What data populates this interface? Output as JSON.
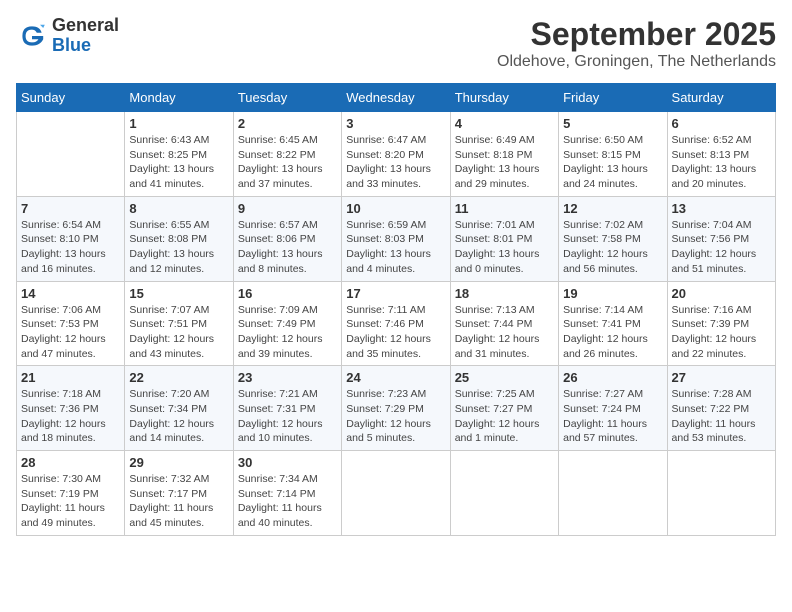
{
  "header": {
    "logo_general": "General",
    "logo_blue": "Blue",
    "month_title": "September 2025",
    "location": "Oldehove, Groningen, The Netherlands"
  },
  "days_of_week": [
    "Sunday",
    "Monday",
    "Tuesday",
    "Wednesday",
    "Thursday",
    "Friday",
    "Saturday"
  ],
  "weeks": [
    [
      {
        "day": "",
        "info": ""
      },
      {
        "day": "1",
        "info": "Sunrise: 6:43 AM\nSunset: 8:25 PM\nDaylight: 13 hours\nand 41 minutes."
      },
      {
        "day": "2",
        "info": "Sunrise: 6:45 AM\nSunset: 8:22 PM\nDaylight: 13 hours\nand 37 minutes."
      },
      {
        "day": "3",
        "info": "Sunrise: 6:47 AM\nSunset: 8:20 PM\nDaylight: 13 hours\nand 33 minutes."
      },
      {
        "day": "4",
        "info": "Sunrise: 6:49 AM\nSunset: 8:18 PM\nDaylight: 13 hours\nand 29 minutes."
      },
      {
        "day": "5",
        "info": "Sunrise: 6:50 AM\nSunset: 8:15 PM\nDaylight: 13 hours\nand 24 minutes."
      },
      {
        "day": "6",
        "info": "Sunrise: 6:52 AM\nSunset: 8:13 PM\nDaylight: 13 hours\nand 20 minutes."
      }
    ],
    [
      {
        "day": "7",
        "info": "Sunrise: 6:54 AM\nSunset: 8:10 PM\nDaylight: 13 hours\nand 16 minutes."
      },
      {
        "day": "8",
        "info": "Sunrise: 6:55 AM\nSunset: 8:08 PM\nDaylight: 13 hours\nand 12 minutes."
      },
      {
        "day": "9",
        "info": "Sunrise: 6:57 AM\nSunset: 8:06 PM\nDaylight: 13 hours\nand 8 minutes."
      },
      {
        "day": "10",
        "info": "Sunrise: 6:59 AM\nSunset: 8:03 PM\nDaylight: 13 hours\nand 4 minutes."
      },
      {
        "day": "11",
        "info": "Sunrise: 7:01 AM\nSunset: 8:01 PM\nDaylight: 13 hours\nand 0 minutes."
      },
      {
        "day": "12",
        "info": "Sunrise: 7:02 AM\nSunset: 7:58 PM\nDaylight: 12 hours\nand 56 minutes."
      },
      {
        "day": "13",
        "info": "Sunrise: 7:04 AM\nSunset: 7:56 PM\nDaylight: 12 hours\nand 51 minutes."
      }
    ],
    [
      {
        "day": "14",
        "info": "Sunrise: 7:06 AM\nSunset: 7:53 PM\nDaylight: 12 hours\nand 47 minutes."
      },
      {
        "day": "15",
        "info": "Sunrise: 7:07 AM\nSunset: 7:51 PM\nDaylight: 12 hours\nand 43 minutes."
      },
      {
        "day": "16",
        "info": "Sunrise: 7:09 AM\nSunset: 7:49 PM\nDaylight: 12 hours\nand 39 minutes."
      },
      {
        "day": "17",
        "info": "Sunrise: 7:11 AM\nSunset: 7:46 PM\nDaylight: 12 hours\nand 35 minutes."
      },
      {
        "day": "18",
        "info": "Sunrise: 7:13 AM\nSunset: 7:44 PM\nDaylight: 12 hours\nand 31 minutes."
      },
      {
        "day": "19",
        "info": "Sunrise: 7:14 AM\nSunset: 7:41 PM\nDaylight: 12 hours\nand 26 minutes."
      },
      {
        "day": "20",
        "info": "Sunrise: 7:16 AM\nSunset: 7:39 PM\nDaylight: 12 hours\nand 22 minutes."
      }
    ],
    [
      {
        "day": "21",
        "info": "Sunrise: 7:18 AM\nSunset: 7:36 PM\nDaylight: 12 hours\nand 18 minutes."
      },
      {
        "day": "22",
        "info": "Sunrise: 7:20 AM\nSunset: 7:34 PM\nDaylight: 12 hours\nand 14 minutes."
      },
      {
        "day": "23",
        "info": "Sunrise: 7:21 AM\nSunset: 7:31 PM\nDaylight: 12 hours\nand 10 minutes."
      },
      {
        "day": "24",
        "info": "Sunrise: 7:23 AM\nSunset: 7:29 PM\nDaylight: 12 hours\nand 5 minutes."
      },
      {
        "day": "25",
        "info": "Sunrise: 7:25 AM\nSunset: 7:27 PM\nDaylight: 12 hours\nand 1 minute."
      },
      {
        "day": "26",
        "info": "Sunrise: 7:27 AM\nSunset: 7:24 PM\nDaylight: 11 hours\nand 57 minutes."
      },
      {
        "day": "27",
        "info": "Sunrise: 7:28 AM\nSunset: 7:22 PM\nDaylight: 11 hours\nand 53 minutes."
      }
    ],
    [
      {
        "day": "28",
        "info": "Sunrise: 7:30 AM\nSunset: 7:19 PM\nDaylight: 11 hours\nand 49 minutes."
      },
      {
        "day": "29",
        "info": "Sunrise: 7:32 AM\nSunset: 7:17 PM\nDaylight: 11 hours\nand 45 minutes."
      },
      {
        "day": "30",
        "info": "Sunrise: 7:34 AM\nSunset: 7:14 PM\nDaylight: 11 hours\nand 40 minutes."
      },
      {
        "day": "",
        "info": ""
      },
      {
        "day": "",
        "info": ""
      },
      {
        "day": "",
        "info": ""
      },
      {
        "day": "",
        "info": ""
      }
    ]
  ]
}
